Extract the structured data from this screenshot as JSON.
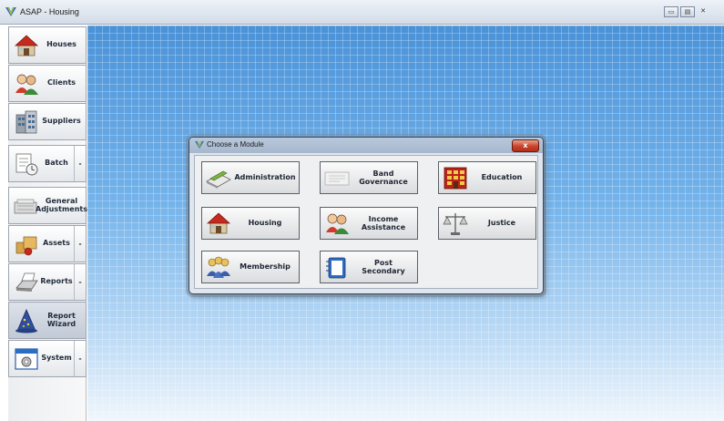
{
  "window": {
    "title": "ASAP - Housing",
    "controls": [
      "restore",
      "maximize",
      "close"
    ]
  },
  "sidebar": {
    "items": [
      {
        "label": "Houses",
        "icon": "house-icon",
        "has_arrow": false
      },
      {
        "label": "Clients",
        "icon": "people-icon",
        "has_arrow": false
      },
      {
        "label": "Suppliers",
        "icon": "building-icon",
        "has_arrow": false
      },
      {
        "label": "Batch",
        "icon": "batch-clock-icon",
        "has_arrow": true
      },
      {
        "label": "General Adjustments",
        "icon": "adjustments-icon",
        "has_arrow": false
      },
      {
        "label": "Assets",
        "icon": "boxes-icon",
        "has_arrow": true
      },
      {
        "label": "Reports",
        "icon": "printer-icon",
        "has_arrow": true
      },
      {
        "label": "Report Wizard",
        "icon": "wizard-hat-icon",
        "has_arrow": false,
        "active": true
      },
      {
        "label": "System",
        "icon": "gear-window-icon",
        "has_arrow": true
      }
    ],
    "arrow_glyph": "-"
  },
  "dialog": {
    "title": "Choose a Module",
    "close_glyph": "x",
    "modules": [
      {
        "label": "Administration",
        "icon": "administration-icon"
      },
      {
        "label": "Band Governance",
        "icon": "band-governance-icon"
      },
      {
        "label": "Education",
        "icon": "education-icon"
      },
      {
        "label": "Housing",
        "icon": "house-icon"
      },
      {
        "label": "Income Assistance",
        "icon": "people-icon"
      },
      {
        "label": "Justice",
        "icon": "scales-icon"
      },
      {
        "label": "Membership",
        "icon": "membership-icon"
      },
      {
        "label": "Post Secondary",
        "icon": "notebook-icon"
      }
    ]
  }
}
